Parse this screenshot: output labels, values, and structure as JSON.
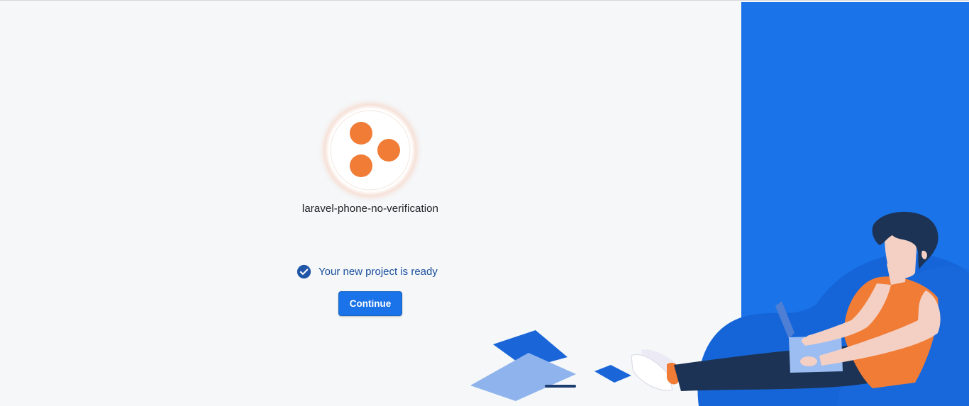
{
  "project": {
    "name": "laravel-phone-no-verification",
    "logo_icon": "three-dots-icon",
    "logo_color": "#f07c36"
  },
  "status": {
    "icon": "check-circle-icon",
    "text": "Your new project is ready"
  },
  "actions": {
    "continue_label": "Continue"
  },
  "colors": {
    "brand_blue": "#1a73e8",
    "background": "#f5f7f9",
    "accent_orange": "#f07c36"
  }
}
